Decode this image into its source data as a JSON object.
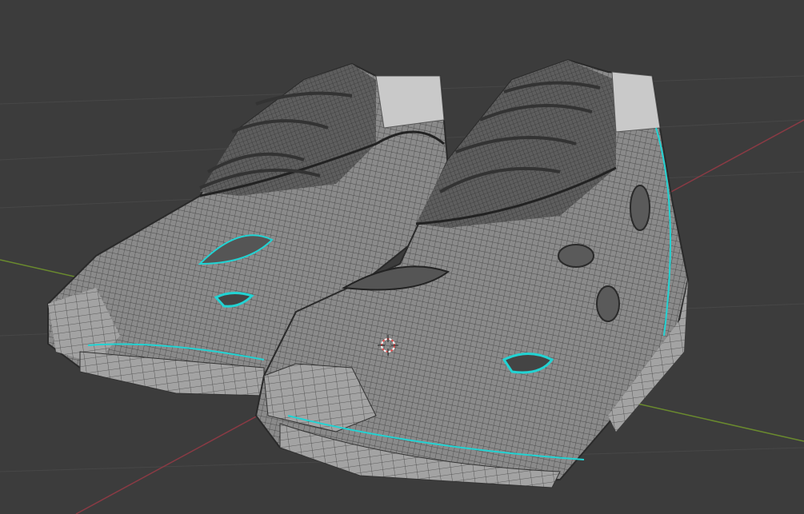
{
  "viewport": {
    "background_color": "#3c3c3c",
    "x_axis_color": "#8a3a44",
    "y_axis_color": "#6a8a2e",
    "mesh_color": "#8c8c8c",
    "wire_color": "#2e2e2e",
    "seam_color": "#22d3d3",
    "cursor_color": "#e05050"
  },
  "objects": [
    {
      "name": "sneaker-left",
      "type": "mesh"
    },
    {
      "name": "sneaker-right",
      "type": "mesh"
    }
  ],
  "icons": [
    "3d-cursor-icon"
  ]
}
